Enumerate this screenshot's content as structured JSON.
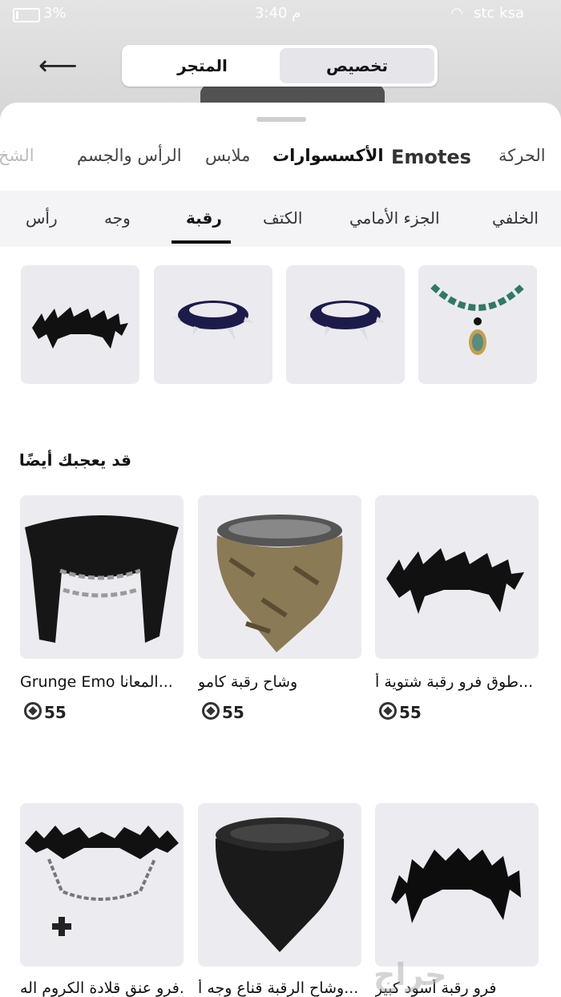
{
  "status": {
    "battery_pct": "3%",
    "time": "3:40 م",
    "carrier": "stc ksa"
  },
  "header": {
    "back_icon": "arrow-left-icon",
    "tabs": [
      "المتجر",
      "تخصيص"
    ],
    "selected_tab": "تخصيص"
  },
  "categories": [
    "الشخ",
    "الرأس والجسم",
    "ملابس",
    "الأكسسوارات",
    "Emotes",
    "الحركة"
  ],
  "active_category": "الأكسسوارات",
  "subcategories": [
    "رأس",
    "وجه",
    "رقبة",
    "الكتف",
    "الجزء الأمامي",
    "الخلفي"
  ],
  "active_subcategory": "رقبة",
  "section_title": "قد يعجبك أيضًا",
  "cards": [
    {
      "name": "Grunge Emo المعانا...",
      "price": "55"
    },
    {
      "name": "وشاح رقبة كامو",
      "price": "55"
    },
    {
      "name": "طوق فرو رقبة شتوية أ...",
      "price": "55"
    },
    {
      "name": "فرو عنق قلادة الكروم اله...",
      "price": ""
    },
    {
      "name": "وشاح الرقبة قناع وجه أ...",
      "price": ""
    },
    {
      "name": "فرو رقبة أسود كبير",
      "price": ""
    }
  ],
  "watermark": "حراج"
}
